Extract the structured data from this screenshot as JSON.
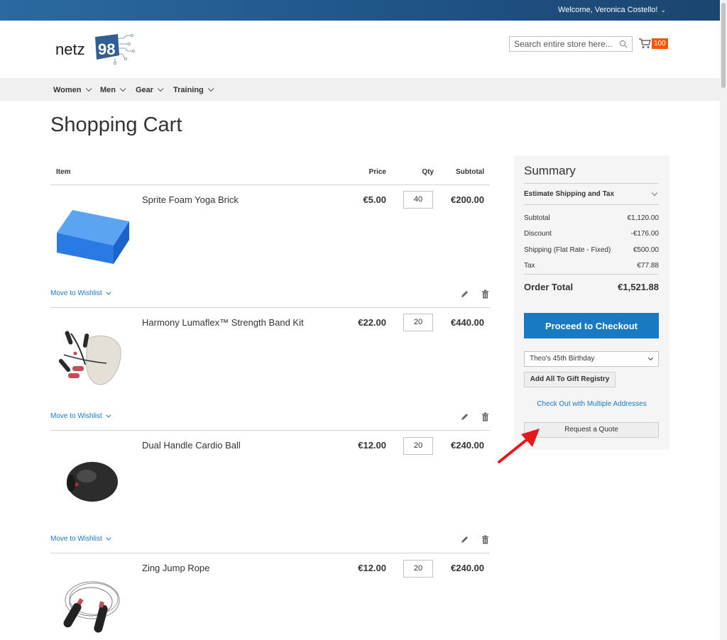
{
  "header": {
    "welcome": "Welcome, Veronica Costello!",
    "logo_text": "netz",
    "logo_number": "98",
    "search_placeholder": "Search entire store here...",
    "cart_count": "100"
  },
  "nav": {
    "items": [
      {
        "label": "Women"
      },
      {
        "label": "Men"
      },
      {
        "label": "Gear"
      },
      {
        "label": "Training"
      }
    ]
  },
  "page": {
    "title": "Shopping Cart"
  },
  "cart": {
    "columns": {
      "item": "Item",
      "price": "Price",
      "qty": "Qty",
      "subtotal": "Subtotal"
    },
    "wishlist_label": "Move to Wishlist",
    "items": [
      {
        "name": "Sprite Foam Yoga Brick",
        "price": "€5.00",
        "qty": "40",
        "subtotal": "€200.00"
      },
      {
        "name": "Harmony Lumaflex™ Strength Band Kit",
        "price": "€22.00",
        "qty": "20",
        "subtotal": "€440.00"
      },
      {
        "name": "Dual Handle Cardio Ball",
        "price": "€12.00",
        "qty": "20",
        "subtotal": "€240.00"
      },
      {
        "name": "Zing Jump Rope",
        "price": "€12.00",
        "qty": "20",
        "subtotal": "€240.00"
      }
    ]
  },
  "summary": {
    "title": "Summary",
    "estimate": "Estimate Shipping and Tax",
    "lines": [
      {
        "label": "Subtotal",
        "value": "€1,120.00"
      },
      {
        "label": "Discount",
        "value": "-€176.00"
      },
      {
        "label": "Shipping (Flat Rate - Fixed)",
        "value": "€500.00"
      },
      {
        "label": "Tax",
        "value": "€77.88"
      }
    ],
    "total_label": "Order Total",
    "total_value": "€1,521.88",
    "checkout": "Proceed to Checkout",
    "registry_selected": "Theo's 45th Birthday",
    "gift_registry_button": "Add All To Gift Registry",
    "multi_address_link": "Check Out with Multiple Addresses",
    "quote_button": "Request a Quote"
  },
  "colors": {
    "topbar": "#1f5286",
    "primary": "#1979c3",
    "cart_badge": "#ff5501",
    "annotation_arrow": "#e3191b"
  }
}
